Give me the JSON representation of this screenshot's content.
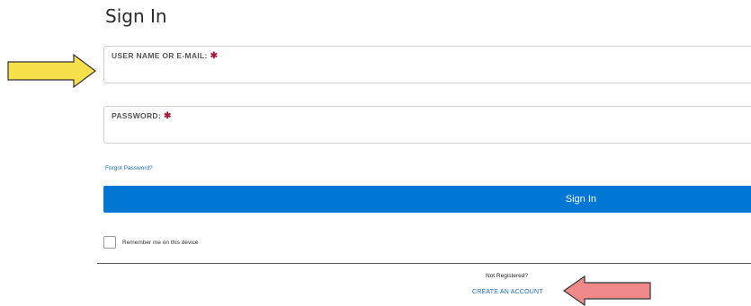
{
  "form": {
    "title": "Sign In",
    "username": {
      "label": "USER NAME OR E-MAIL:",
      "required_marker": "✱",
      "value": "",
      "placeholder": ""
    },
    "password": {
      "label": "PASSWORD:",
      "required_marker": "✱",
      "value": "",
      "placeholder": ""
    },
    "forgot_password": "Forgot Password?",
    "submit_label": "Sign In",
    "remember_me": {
      "label": "Remember me on this device",
      "checked": false
    }
  },
  "register": {
    "prompt": "Not Registered?",
    "link_label": "CREATE AN ACCOUNT"
  },
  "annotations": {
    "arrow_yellow_color": "#f7e14a",
    "arrow_pink_color": "#f08a8a"
  },
  "colors": {
    "primary": "#0077d4",
    "link": "#1a6fc2",
    "required": "#a51d3a"
  }
}
